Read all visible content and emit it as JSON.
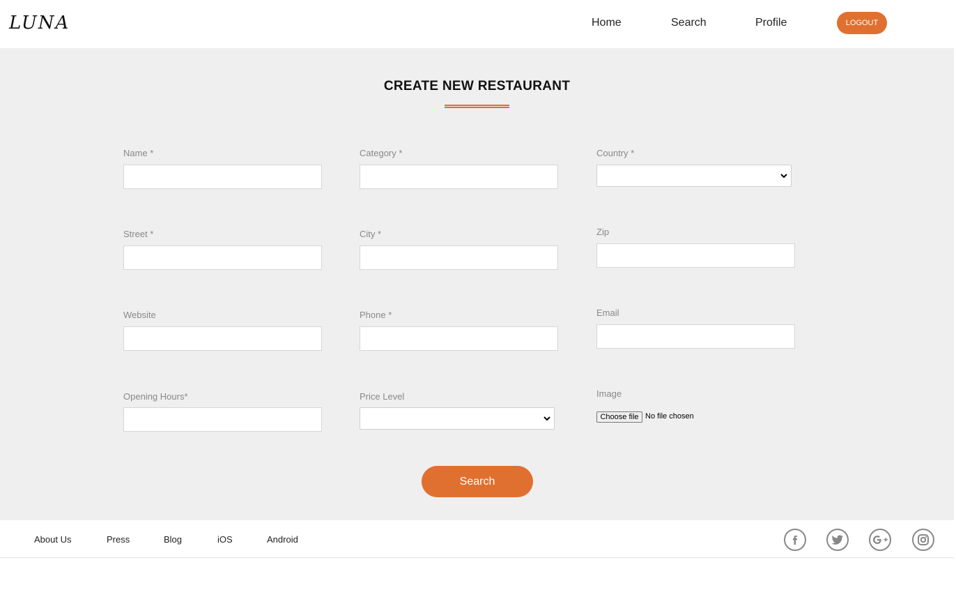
{
  "header": {
    "logo": "LUNA",
    "nav": [
      "Home",
      "Search",
      "Profile"
    ],
    "logout_label": "LOGOUT"
  },
  "page": {
    "title": "CREATE NEW RESTAURANT"
  },
  "form": {
    "name_label": "Name *",
    "category_label": "Category *",
    "country_label": "Country *",
    "street_label": "Street *",
    "city_label": "City *",
    "zip_label": "Zip",
    "website_label": "Website",
    "phone_label": "Phone *",
    "email_label": "Email",
    "opening_hours_label": "Opening Hours*",
    "price_level_label": "Price Level",
    "image_label": "Image",
    "choose_file_label": "Choose file",
    "no_file_text": "No file chosen",
    "submit_label": "Search"
  },
  "footer": {
    "links": [
      "About Us",
      "Press",
      "Blog",
      "iOS",
      "Android"
    ],
    "social_icons": [
      "facebook-icon",
      "twitter-icon",
      "google-plus-icon",
      "instagram-icon"
    ]
  },
  "colors": {
    "accent": "#e07030",
    "background": "#efefef",
    "label": "#888888"
  }
}
